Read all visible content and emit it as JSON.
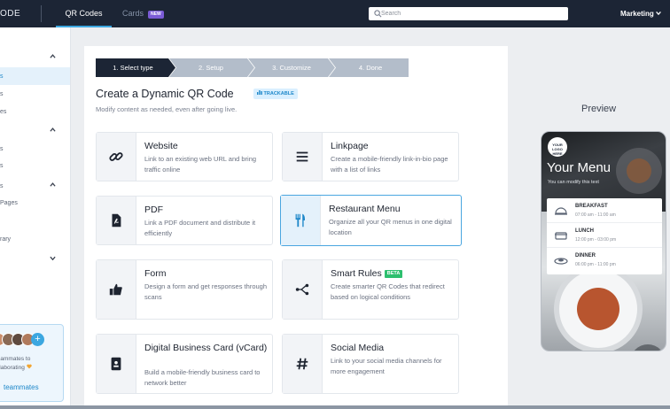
{
  "topbar": {
    "brand": "ODE",
    "nav_qr": "QR Codes",
    "nav_cards": "Cards",
    "nav_cards_badge": "NEW",
    "search_placeholder": "Search",
    "workspace": "Marketing"
  },
  "sidebar": {
    "items": [
      "s",
      "s",
      "es",
      "s",
      "s",
      "s",
      "Pages",
      "rary"
    ],
    "invite_line1": "r teammates to",
    "invite_line2": "collaborating",
    "invite_link": "teammates"
  },
  "stepper": [
    "1. Select type",
    "2. Setup",
    "3. Customize",
    "4. Done"
  ],
  "main": {
    "heading": "Create a Dynamic QR Code",
    "trackable_badge": "TRACKABLE",
    "subheading": "Modify content as needed, even after going live."
  },
  "tiles": [
    {
      "title": "Website",
      "desc": "Link to an existing web URL and bring traffic online",
      "icon": "link-icon"
    },
    {
      "title": "Linkpage",
      "desc": "Create a mobile-friendly link-in-bio page with a list of links",
      "icon": "list-icon"
    },
    {
      "title": "PDF",
      "desc": "Link a PDF document and distribute it efficiently",
      "icon": "pdf-icon"
    },
    {
      "title": "Restaurant Menu",
      "desc": "Organize all your QR menus in one digital location",
      "icon": "utensils-icon"
    },
    {
      "title": "Form",
      "desc": "Design a form and get responses through scans",
      "icon": "thumbs-up-icon"
    },
    {
      "title": "Smart Rules",
      "badge": "BETA",
      "desc": "Create smarter QR Codes that redirect based on logical conditions",
      "icon": "branch-icon"
    },
    {
      "title": "Digital Business Card (vCard)",
      "desc": "Build a mobile-friendly business card to network better",
      "icon": "id-card-icon"
    },
    {
      "title": "Social Media",
      "desc": "Link to your social media channels for more engagement",
      "icon": "hashtag-icon"
    }
  ],
  "preview": {
    "title": "Preview",
    "logo_text": "YOUR LOGO HERE",
    "menu_title": "Your Menu",
    "menu_sub": "You can modify this text",
    "meals": [
      {
        "name": "BREAKFAST",
        "time": "07:00 am - 11:00 am"
      },
      {
        "name": "LUNCH",
        "time": "12:00 pm - 03:00 pm"
      },
      {
        "name": "DINNER",
        "time": "06:00 pm - 11:00 pm"
      }
    ]
  },
  "colors": {
    "topbar": "#1c2535",
    "accent": "#3ca7e0",
    "selected_border": "#4aa6e0",
    "beta": "#2dbf6e",
    "new_badge": "#7b5cd6"
  }
}
